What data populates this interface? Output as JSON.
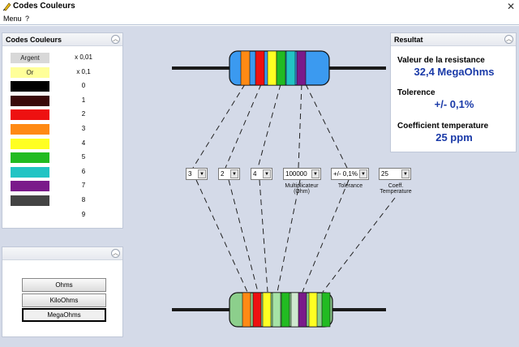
{
  "window": {
    "title": "Codes Couleurs",
    "close_glyph": "✕"
  },
  "menubar": {
    "items": [
      "Menu",
      "?"
    ]
  },
  "codes_panel": {
    "title": "Codes Couleurs",
    "rows": [
      {
        "swatch_label": "Argent",
        "value": "x 0,01",
        "color": "#d8d8d8",
        "text_color": "#222222"
      },
      {
        "swatch_label": "Or",
        "value": "x 0,1",
        "color": "#ffff99",
        "text_color": "#222222"
      },
      {
        "swatch_label": "",
        "value": "0",
        "color": "#000000"
      },
      {
        "swatch_label": "",
        "value": "1",
        "color": "#3a0a0a"
      },
      {
        "swatch_label": "",
        "value": "2",
        "color": "#ee1111"
      },
      {
        "swatch_label": "",
        "value": "3",
        "color": "#ff8a14"
      },
      {
        "swatch_label": "",
        "value": "4",
        "color": "#ffff22"
      },
      {
        "swatch_label": "",
        "value": "5",
        "color": "#22bb22"
      },
      {
        "swatch_label": "",
        "value": "6",
        "color": "#22c4c4"
      },
      {
        "swatch_label": "",
        "value": "7",
        "color": "#7a1a8a"
      },
      {
        "swatch_label": "",
        "value": "8",
        "color": "#444444"
      },
      {
        "swatch_label": "",
        "value": "9",
        "color": "#ffffff"
      }
    ]
  },
  "units_panel": {
    "buttons": [
      "Ohms",
      "KiloOhms",
      "MegaOhms"
    ],
    "selected": "MegaOhms"
  },
  "result_panel": {
    "title": "Resultat",
    "resistance_label": "Valeur de la resistance",
    "resistance_value": "32,4 MegaOhms",
    "tolerance_label": "Tolerence",
    "tolerance_value": "+/- 0,1%",
    "coeff_label": "Coefficient temperature",
    "coeff_value": "25 ppm"
  },
  "selectors": {
    "digit1": "3",
    "digit2": "2",
    "digit3": "4",
    "multiplier": "100000",
    "tolerance": "+/- 0,1%",
    "coeff": "25",
    "labels": {
      "multiplier": [
        "Multiplicateur",
        "(Ohm)"
      ],
      "tolerance": [
        "Tolerance"
      ],
      "coeff": [
        "Coeff.",
        "Temperature"
      ]
    }
  },
  "top_resistor": {
    "body_color": "#3b9af0",
    "bands": [
      "#ff8a14",
      "#ee1111",
      "#ffff22",
      "#22bb22",
      "#22c4c4",
      "#7a1a8a"
    ]
  },
  "bottom_resistor": {
    "body_color": "#8ccf8c",
    "bands": [
      "#ff8a14",
      "#ee1111",
      "#ffff22",
      "#a6e3a6",
      "#22bb22",
      "#cfe8cf",
      "#7a1a8a",
      "#ffff22",
      "#22bb22"
    ]
  }
}
